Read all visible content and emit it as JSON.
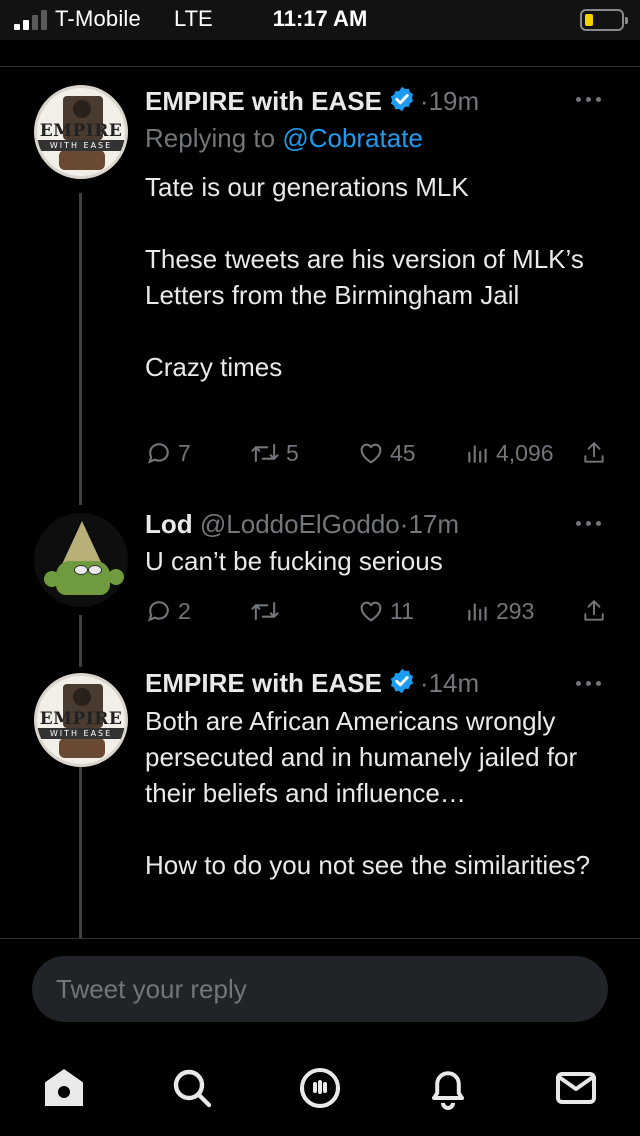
{
  "status_bar": {
    "carrier": "T-Mobile",
    "network": "LTE",
    "time": "11:17 AM",
    "signal_bars_filled": 2,
    "signal_bars_total": 4,
    "battery_color": "#f5d000"
  },
  "tweets": [
    {
      "name": "EMPIRE with EASE",
      "verified": true,
      "separator": "·",
      "time": "19m",
      "replying_prefix": "Replying to ",
      "replying_to": "@Cobratate",
      "avatar": {
        "logo_text": "EMPIRE",
        "logo_sub": "WITH EASE"
      },
      "text": "Tate is our generations MLK\n\nThese tweets are his version of MLK’s Letters from the Birmingham Jail\n\nCrazy times",
      "replies": "7",
      "retweets": "5",
      "likes": "45",
      "views": "4,096"
    },
    {
      "name": "Lod",
      "handle": "@LoddoElGoddo",
      "separator": "·",
      "time": "17m",
      "text": "U can’t be fucking serious",
      "replies": "2",
      "retweets": "",
      "likes": "11",
      "views": "293"
    },
    {
      "name": "EMPIRE with EASE",
      "verified": true,
      "separator": "·",
      "time": "14m",
      "avatar": {
        "logo_text": "EMPIRE",
        "logo_sub": "WITH EASE"
      },
      "text": "Both are African Americans wrongly persecuted and in humanely jailed for their beliefs and influence…\n\nHow to do you not see the similarities?"
    }
  ],
  "reply_box": {
    "placeholder": "Tweet your reply"
  },
  "tab_bar": [
    "home-icon",
    "search-icon",
    "spaces-icon",
    "notifications-icon",
    "messages-icon"
  ],
  "colors": {
    "accent": "#1d9bf0",
    "muted": "#71767b",
    "text": "#e7e9ea",
    "background": "#000000"
  }
}
